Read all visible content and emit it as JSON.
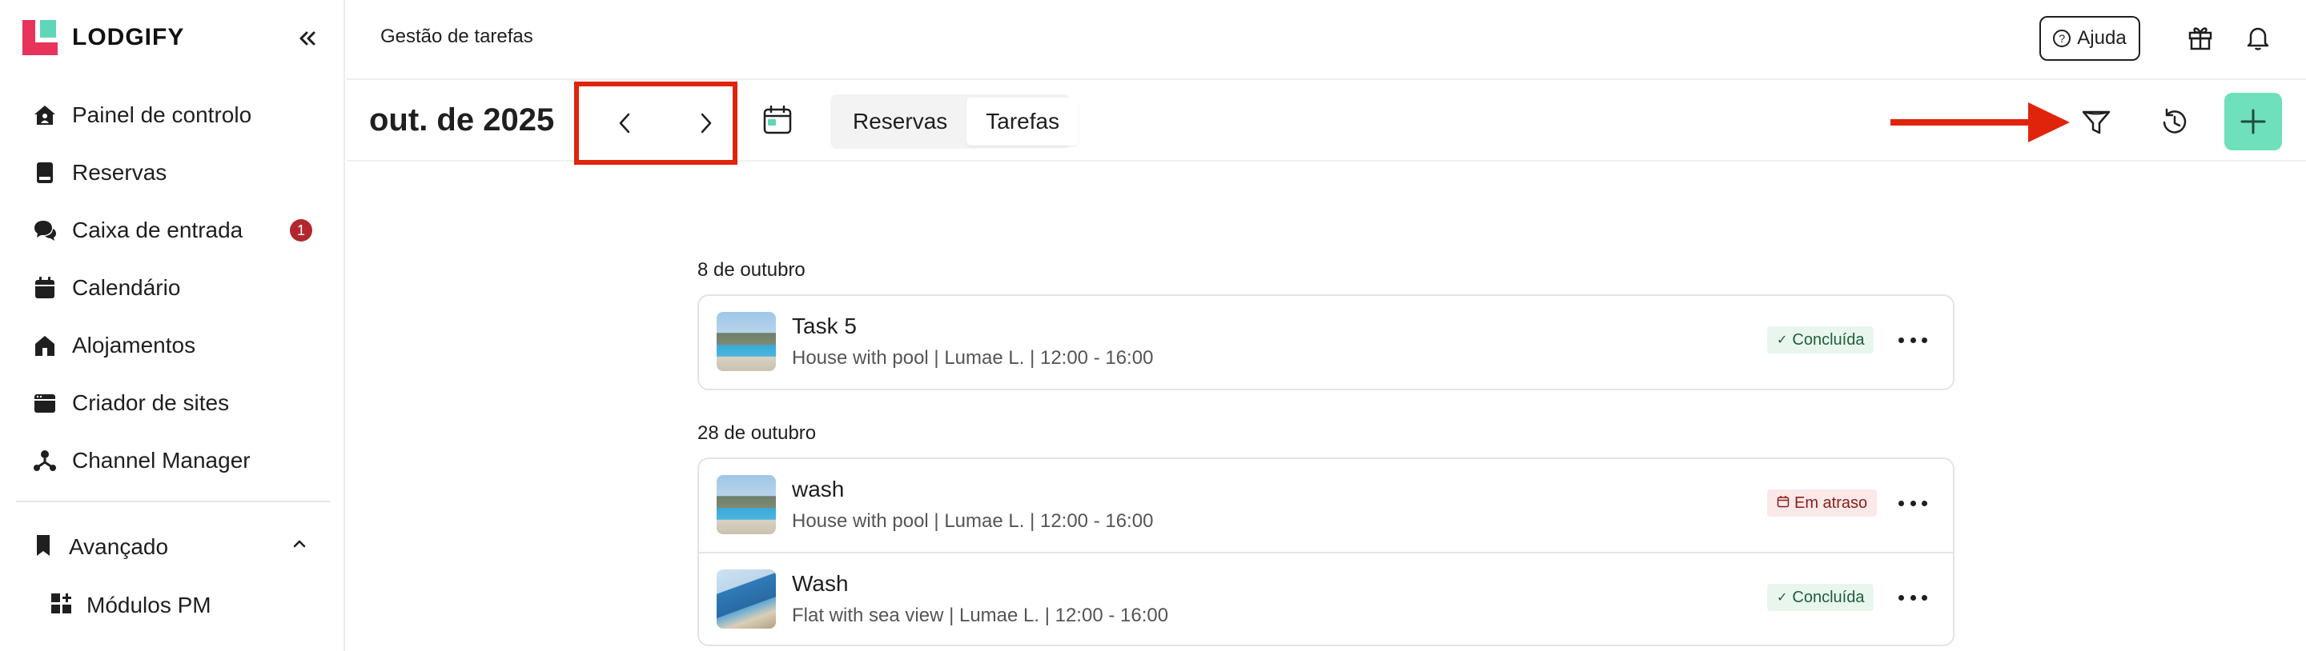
{
  "sidebar": {
    "logo_text": "LODGIFY",
    "items": [
      {
        "label": "Painel de controlo",
        "icon": "home-icon"
      },
      {
        "label": "Reservas",
        "icon": "book-icon"
      },
      {
        "label": "Caixa de entrada",
        "icon": "chat-icon",
        "badge": "1"
      },
      {
        "label": "Calendário",
        "icon": "calendar-icon"
      },
      {
        "label": "Alojamentos",
        "icon": "house-icon"
      },
      {
        "label": "Criador de sites",
        "icon": "browser-icon"
      },
      {
        "label": "Channel Manager",
        "icon": "network-icon"
      }
    ],
    "advanced": {
      "label": "Avançado",
      "icon": "bookmark-icon"
    },
    "sub_item": {
      "label": "Módulos PM",
      "icon": "modules-icon"
    }
  },
  "header": {
    "title": "Gestão de tarefas",
    "help_label": "Ajuda"
  },
  "toolbar": {
    "month": "out. de 2025",
    "tabs": [
      {
        "label": "Reservas",
        "active": false
      },
      {
        "label": "Tarefas",
        "active": true
      }
    ]
  },
  "groups": [
    {
      "date": "8 de outubro",
      "tasks": [
        {
          "title": "Task 5",
          "subtitle": "House with pool | Lumae L. | 12:00 - 16:00",
          "status": "Concluída",
          "status_type": "done"
        }
      ]
    },
    {
      "date": "28 de outubro",
      "tasks": [
        {
          "title": "wash",
          "subtitle": "House with pool | Lumae L. | 12:00 - 16:00",
          "status": "Em atraso",
          "status_type": "late"
        },
        {
          "title": "Wash",
          "subtitle": "Flat with sea view | Lumae L. | 12:00 - 16:00",
          "status": "Concluída",
          "status_type": "done"
        }
      ]
    }
  ],
  "colors": {
    "brand_red": "#e8345a",
    "brand_green": "#5fd6b5",
    "add_button": "#6ee0bb",
    "annotation_red": "#e0240c",
    "badge_red": "#b3262e"
  }
}
